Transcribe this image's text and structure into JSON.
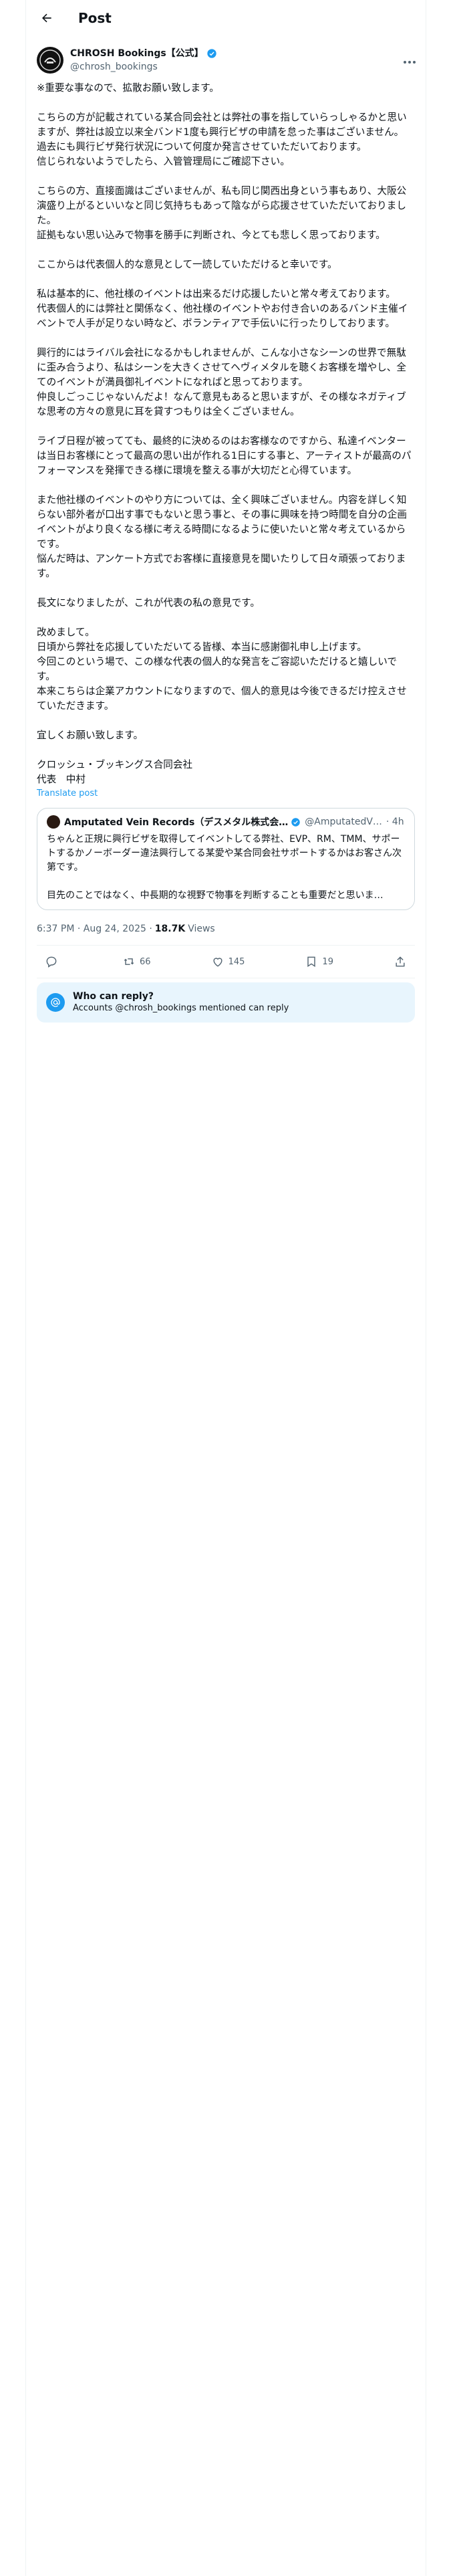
{
  "header": {
    "title": "Post"
  },
  "author": {
    "name": "CHROSH Bookings【公式】",
    "handle": "@chrosh_bookings"
  },
  "post": {
    "body": "※重要な事なので、拡散お願い致します。\n\nこちらの方が記載されている某合同会社とは弊社の事を指していらっしゃるかと思いますが、弊社は設立以来全バンド1度も興行ビザの申請を怠った事はございません。\n過去にも興行ビザ発行状況について何度か発言させていただいております。\n信じられないようでしたら、入管管理局にご確認下さい。\n\nこちらの方、直接面識はございませんが、私も同じ関西出身という事もあり、大阪公演盛り上がるといいなと同じ気持ちもあって陰ながら応援させていただいておりました。\n証拠もない思い込みで物事を勝手に判断され、今とても悲しく思っております。\n\nここからは代表個人的な意見として一読していただけると幸いです。\n\n私は基本的に、他社様のイベントは出来るだけ応援したいと常々考えております。\n代表個人的には弊社と関係なく、他社様のイベントやお付き合いのあるバンド主催イベントで人手が足りない時など、ボランティアで手伝いに行ったりしております。\n\n興行的にはライバル会社になるかもしれませんが、こんな小さなシーンの世界で無駄に歪み合うより、私はシーンを大きくさせてヘヴィメタルを聴くお客様を増やし、全てのイベントが満員御礼イベントになればと思っております。\n仲良しごっこじゃないんだよ！なんて意見もあると思いますが、その様なネガティブな思考の方々の意見に耳を貸すつもりは全くございません。\n\nライブ日程が被ってても、最終的に決めるのはお客様なのですから、私達イベンターは当日お客様にとって最高の思い出が作れる1日にする事と、アーティストが最高のパフォーマンスを発揮できる様に環境を整える事が大切だと心得ています。\n\nまた他社様のイベントのやり方については、全く興味ございません。内容を詳しく知らない部外者が口出す事でもないと思う事と、その事に興味を持つ時間を自分の企画イベントがより良くなる様に考える時間になるように使いたいと常々考えているからです。\n悩んだ時は、アンケート方式でお客様に直接意見を聞いたりして日々頑張っております。\n\n長文になりましたが、これが代表の私の意見です。\n\n改めまして。\n日頃から弊社を応援していただいてる皆様、本当に感謝御礼申し上げます。\n今回このという場で、この様な代表の個人的な発言をご容認いただけると嬉しいです。\n本来こちらは企業アカウントになりますので、個人的意見は今後できるだけ控えさせていただきます。\n\n宜しくお願い致します。\n\nクロッシュ・ブッキングス合同会社\n代表　中村",
    "translate_label": "Translate post",
    "timestamp": "6:37 PM · Aug 24, 2025 ·",
    "views_count": "18.7K",
    "views_label": "Views"
  },
  "quote": {
    "name": "Amputated Vein Records（デスメタル株式会…",
    "handle": "@AmputatedV…",
    "time": "· 4h",
    "text": "ちゃんと正規に興行ビザを取得してイベントしてる弊社、EVP、RM、TMM、サポートするかノーボーダー違法興行してる某愛や某合同会社サポートするかはお客さん次第です。\n\n目先のことではなく、中長期的な視野で物事を判断することも重要だと思いま…"
  },
  "actions": {
    "reply_count": "",
    "retweet_count": "66",
    "like_count": "145",
    "bookmark_count": "19"
  },
  "who_can_reply": {
    "title": "Who can reply?",
    "subtitle": "Accounts @chrosh_bookings mentioned can reply"
  },
  "colors": {
    "accent": "#1d9bf0",
    "muted": "#536471",
    "text": "#0f1419"
  }
}
